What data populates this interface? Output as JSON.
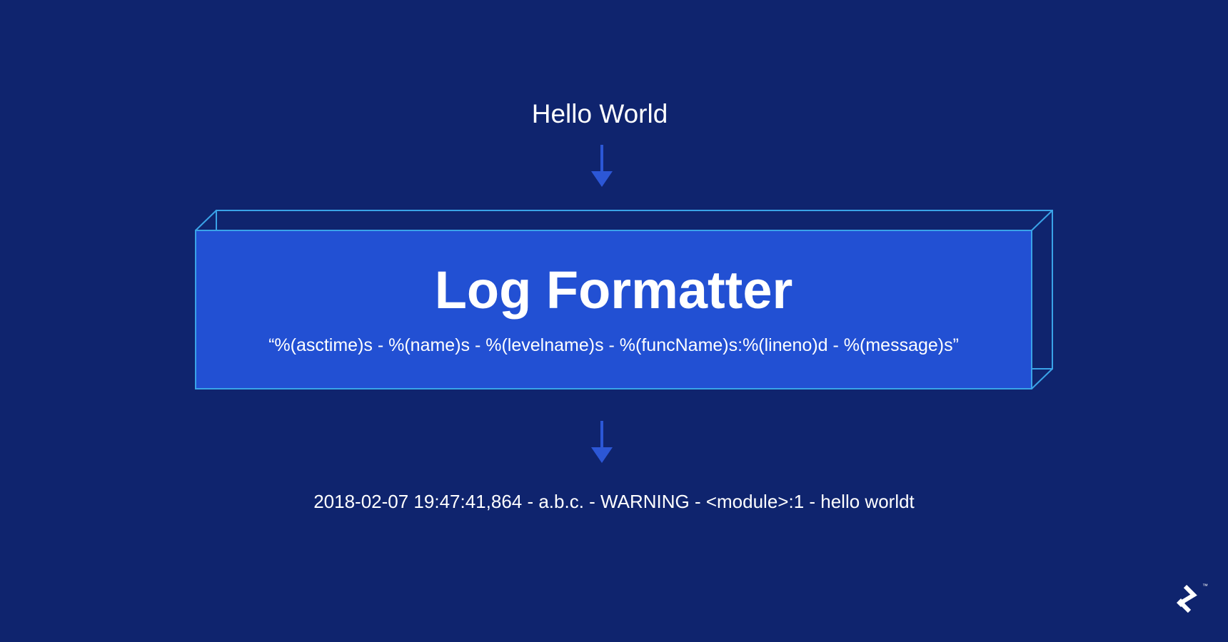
{
  "input": {
    "text": "Hello World"
  },
  "formatter": {
    "title": "Log Formatter",
    "format_string": "“%(asctime)s - %(name)s - %(levelname)s - %(funcName)s:%(lineno)d - %(message)s”"
  },
  "output": {
    "text": "2018-02-07 19:47:41,864 - a.b.c. - WARNING - <module>:1 - hello worldt"
  },
  "logo": {
    "icon": "toptal-logo-icon",
    "trademark": "™"
  },
  "colors": {
    "background": "#0f246e",
    "box_fill": "#2250d3",
    "box_outline": "#3aa3e8",
    "arrow": "#2c57d6",
    "text": "#ffffff"
  }
}
